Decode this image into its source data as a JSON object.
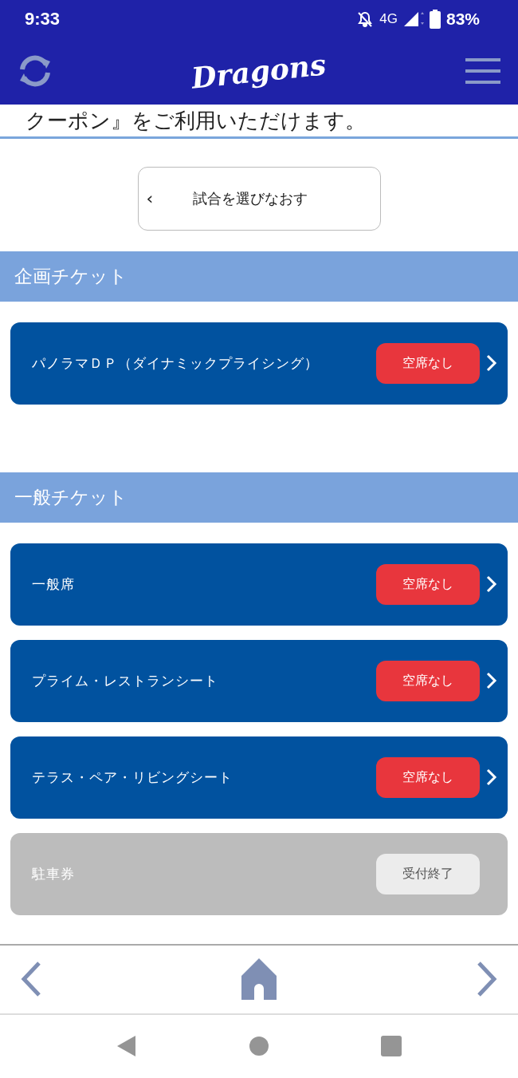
{
  "status_bar": {
    "time": "9:33",
    "network": "4G",
    "battery": "83%"
  },
  "header": {
    "logo": "Dragons"
  },
  "notice": "クーポン』をご利用いただけます。",
  "back_button": {
    "arrow": "‹",
    "label": "試合を選びなおす"
  },
  "sections": [
    {
      "title": "企画チケット",
      "items": [
        {
          "name": "パノラマＤＰ（ダイナミックプライシング）",
          "status": "空席なし",
          "disabled": false
        }
      ]
    },
    {
      "title": "一般チケット",
      "items": [
        {
          "name": "一般席",
          "status": "空席なし",
          "disabled": false
        },
        {
          "name": "プライム・レストランシート",
          "status": "空席なし",
          "disabled": false
        },
        {
          "name": "テラス・ペア・リビングシート",
          "status": "空席なし",
          "disabled": false
        },
        {
          "name": "駐車券",
          "status": "受付終了",
          "disabled": true
        }
      ]
    }
  ]
}
